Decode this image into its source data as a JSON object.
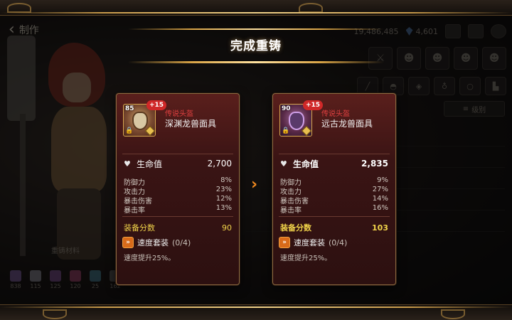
{
  "header": {
    "back_label": "制作",
    "gold": "19,486,485",
    "gems": "4,601"
  },
  "title": "完成重铸",
  "left_panel": {
    "materials_label": "重铸材料",
    "materials": [
      {
        "count": "838",
        "color": "#8a6ab0"
      },
      {
        "count": "115",
        "color": "#9a9aa8"
      },
      {
        "count": "125",
        "color": "#8a5aa0"
      },
      {
        "count": "120",
        "color": "#b04a7a"
      },
      {
        "count": "25",
        "color": "#4a8aa0"
      },
      {
        "count": "162",
        "color": "#6a6a6a"
      }
    ]
  },
  "right_panel": {
    "filter_label": "级别"
  },
  "old_item": {
    "level": "85",
    "enhance": "+15",
    "rarity": "传说头盔",
    "name": "深渊龙兽面具",
    "hp_label": "生命值",
    "hp_value": "2,700",
    "substats": [
      {
        "label": "防御力",
        "value": "8%"
      },
      {
        "label": "攻击力",
        "value": "23%"
      },
      {
        "label": "暴击伤害",
        "value": "12%"
      },
      {
        "label": "暴击率",
        "value": "13%"
      }
    ],
    "score_label": "装备分数",
    "score_value": "90",
    "set_name": "速度套装",
    "set_count": "(0/4)",
    "set_desc": "速度提升25%。"
  },
  "new_item": {
    "level": "90",
    "enhance": "+15",
    "rarity": "传说头盔",
    "name": "远古龙兽面具",
    "hp_label": "生命值",
    "hp_value": "2,835",
    "substats": [
      {
        "label": "防御力",
        "value": "9%"
      },
      {
        "label": "攻击力",
        "value": "27%"
      },
      {
        "label": "暴击伤害",
        "value": "14%"
      },
      {
        "label": "暴击率",
        "value": "16%"
      }
    ],
    "score_label": "装备分数",
    "score_value": "103",
    "set_name": "速度套装",
    "set_count": "(0/4)",
    "set_desc": "速度提升25%。"
  },
  "colors": {
    "rarity": "#e04040",
    "score": "#f0d34a",
    "arrow": "#f08a20",
    "gold_trim": "#d9a446"
  }
}
